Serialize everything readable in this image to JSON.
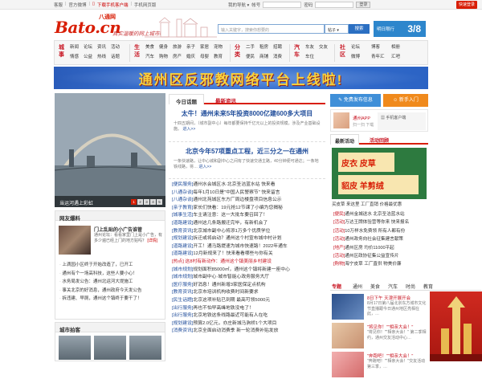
{
  "topbar": {
    "links": [
      "客服",
      "官方微博",
      "下载手机客户端",
      "手机网页版"
    ],
    "nav_label": "我的导航 ▾",
    "account_label": "帐号",
    "password_label": "密码",
    "login_label": "登录",
    "quick_login_label": "快速登录"
  },
  "header": {
    "logo_main": "Bato.cn",
    "logo_cn": "八通网",
    "slogan": "真实温暖的网上城市!",
    "search_placeholder": "输入关键字，搜索你想要的",
    "search_category": "帖子 ▾",
    "search_button": "搜索",
    "date_label": "明日限行",
    "date_value": "3/8"
  },
  "nav": {
    "groups": [
      {
        "cat": "城事",
        "items": [
          "新闻",
          "论坛",
          "资讯",
          "活动",
          "情感",
          "公益",
          "热线",
          "话题"
        ]
      },
      {
        "cat": "生活",
        "items": [
          "美食",
          "健身",
          "旅游",
          "亲子",
          "家居",
          "宠物",
          "汽车",
          "购物",
          "房产",
          "婚庆",
          "母婴",
          "教育"
        ]
      },
      {
        "cat": "分类",
        "items": [
          "二手",
          "租房",
          "招聘",
          "便民",
          "商铺",
          "消费"
        ]
      },
      {
        "cat": "汽车",
        "items": [
          "车友",
          "交友",
          "车位"
        ]
      },
      {
        "cat": "社区",
        "items": [
          "论坛",
          "博客",
          "相册",
          "微博",
          "青年汇",
          "汇吧"
        ]
      }
    ]
  },
  "banner": {
    "text": "通州区反邪教网络平台上线啦!"
  },
  "slider": {
    "caption": "当运河遇上彩虹",
    "pages": [
      "1",
      "2",
      "3",
      "4",
      "5"
    ]
  },
  "news_box": {
    "title": "网友爆料",
    "feature_title": "门上乱贴的小广告谁管",
    "feature_desc": "通州论坛：看看家里门上是小广告，有多少遍已经上门的地方贴吗？",
    "feature_more": "[详情]",
    "list": [
      "上滴园小区终于开始改造了，已开工",
      "通州有个一场高科技，这些人要小心！",
      "水务局发公告：通州北运河大堤施工",
      "事关北京的好消息，通州政府今天发公告",
      "拆违建、早厕，通州这个镇终于要干了！"
    ]
  },
  "city_box": {
    "title": "城市拍客"
  },
  "mid": {
    "tab_active": "今日话题",
    "tab_other": "最新资讯",
    "headline1": "太牛！通州未来5年投资8000亿建600多大项目",
    "desc1": "十四五期间，（城市副中心）每年都要保持千亿元以上的投资规模，涉及产业基础设施。",
    "desc1_more": "进入>>",
    "headline2": "北京今年57项重点工程，近三分之一在通州",
    "desc2": "一条快速路，让中心城和副中心之间有了快速交通主路，40分钟便可通达；一条地铁线路，将…",
    "desc2_more": "进入>>",
    "list": [
      {
        "tag": "[便民服务]",
        "text": "通州水会城区水·北京圣洁蓝水站 快来看"
      },
      {
        "tag": "[八通杂谈]",
        "text": "每年1月10日是\"中国人民警察节\" 快来留言"
      },
      {
        "tag": "[八通杂谈]",
        "text": "通州北苑城区东方厂周边楼盘项目信息公示"
      },
      {
        "tag": "[亲子教育]",
        "text": "家长们快看：19元抢12节课了小编为您揭秘"
      },
      {
        "tag": "[城事生活]",
        "text": "车主请注意：这一大批车要召回了！"
      },
      {
        "tag": "[道路建设]",
        "text": "通州这几条路搬迁完毕，有新机会了"
      },
      {
        "tag": "[教育资讯]",
        "text": "北京城市副中心将添1万多个优质学位"
      },
      {
        "tag": "[规划建设]",
        "text": "拆迁或将启动？通州这个村宣布城中村计划"
      },
      {
        "tag": "[道路建设]",
        "text": "开工！通马路提速为城市快速路！2022年通车"
      },
      {
        "tag": "[道路建设]",
        "text": "12月新规来了！快来看看哪些与你有关"
      }
    ],
    "red_item": "[热点] 这8村有新动作：通州这个镇美丽乡村建设",
    "list2": [
      {
        "tag": "[城市规划]",
        "text": "规划面积85000㎡，通州这个镇将新建一座中心"
      },
      {
        "tag": "[城市规划]",
        "text": "城市副中心·城市智能心政务服务大厅"
      },
      {
        "tag": "[医疗服务]",
        "text": "好消息！通州新增3家医保定点机构"
      },
      {
        "tag": "[教育资讯]",
        "text": "北京市培训机构收费时间新要求"
      },
      {
        "tag": "[民生话题]",
        "text": "北京这项补贴已到期 最高可领5000元"
      },
      {
        "tag": "[出行服务]",
        "text": "再也不怕早高峰地铁没电了！"
      },
      {
        "tag": "[出行服务]",
        "text": "北京地铁这条线路最近可能有人在吃"
      },
      {
        "tag": "[规划建设]",
        "text": "预算2.0亿元，亦庄新城马驹桥1个大项目"
      },
      {
        "tag": "[消费资讯]",
        "text": "北京全面启动消费季 新一轮消费补贴发放"
      }
    ]
  },
  "right": {
    "btn_free": "免费发布信息",
    "btn_guide": "新手入门",
    "app_label": "通州APP",
    "app_subtitle": "扫一扫 下载",
    "qr_text": "手机客户端",
    "tab_active": "最新活动",
    "tab_other": "活动回顾",
    "ad_caption": "买皮草 来这里 工厂直销 价格最优惠",
    "ad_row1": "皮衣 皮草",
    "ad_row2": "貂皮 羊剪绒",
    "list": [
      {
        "tag": "[便民]",
        "text": "通州金城送水 北京圣洁蓝水站"
      },
      {
        "tag": "[活动]",
        "text": "万达王牌体验营等你来 快来报名"
      },
      {
        "tag": "[活动]",
        "text": "10万样水免费领 所有人都有份"
      },
      {
        "tag": "[活动]",
        "text": "通州政务向社会征集建言献策"
      },
      {
        "tag": "[地产]",
        "text": "通州区房 均价11000平起"
      },
      {
        "tag": "[活动]",
        "text": "通州区政协征集公益宣传片"
      },
      {
        "tag": "[购物]",
        "text": "海宁皮草 工厂直供 物美价廉"
      }
    ],
    "tabs2": [
      "专题",
      "通州",
      "美食",
      "汽车",
      "时尚",
      "教育"
    ],
    "card1_title": "8日下午 天津开展开会",
    "card1_desc": "8月17日第八届北京东方城市文化节直播跟今日通州地区亮相在此，…",
    "card2_title": "\"将见你！\"\"相亲大会！\"",
    "card2_desc": "\"将见你！\"\"相亲大会！\" 第二季相约，通州交友活动中心…",
    "card3_title": "\"奔跑吧！\"\"相亲大会！\"",
    "card3_desc": "\"奔跑吧！\"\"相亲大会！\"交友活动第三季，…"
  },
  "colors": {
    "brand_red": "#d81e06",
    "brand_blue": "#2b6fc2",
    "banner_yellow": "#f9d23c"
  }
}
